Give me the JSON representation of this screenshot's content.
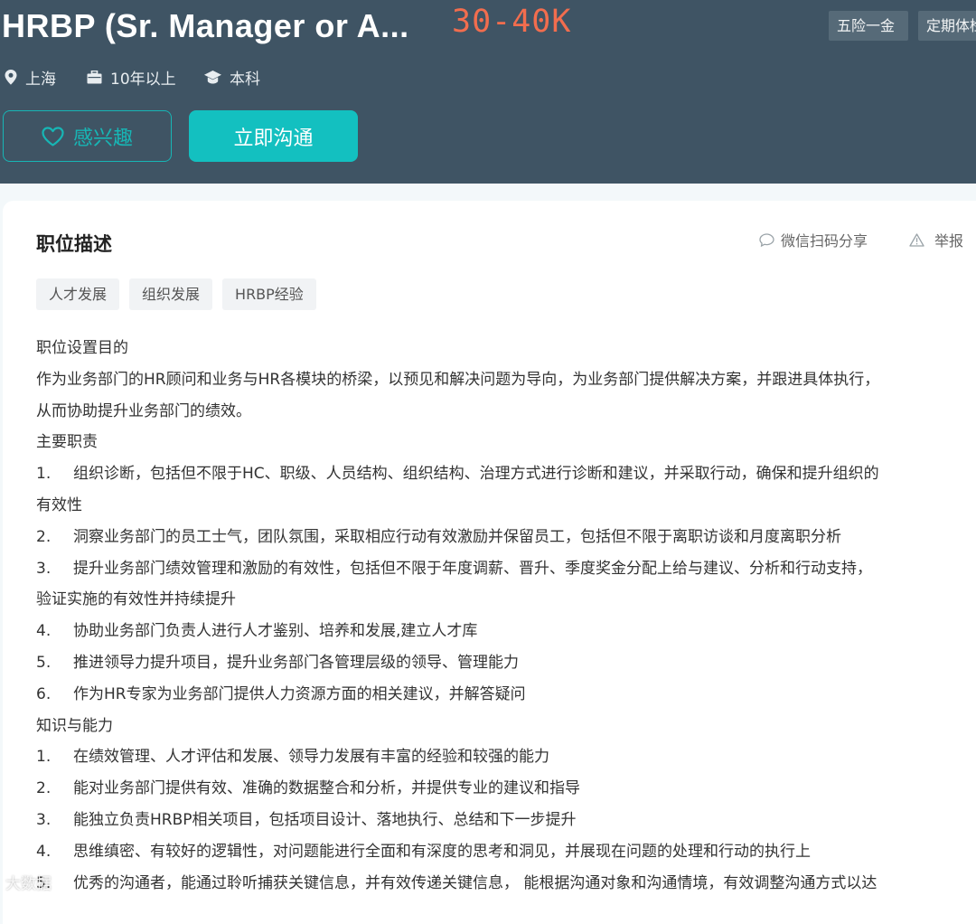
{
  "job": {
    "title": "HRBP (Sr. Manager or A...",
    "salary": "30-40K",
    "welfare": [
      "五险一金",
      "定期体检"
    ],
    "city": "上海",
    "experience": "10年以上",
    "education": "本科"
  },
  "actions": {
    "interest_label": "感兴趣",
    "chat_label": "立即沟通"
  },
  "section": {
    "title": "职位描述",
    "share_label": "微信扫码分享",
    "report_label": "举报",
    "tags": [
      "人才发展",
      "组织发展",
      "HRBP经验"
    ]
  },
  "description": {
    "heading1": "职位设置目的",
    "purpose_line1": "作为业务部门的HR顾问和业务与HR各模块的桥梁，以预见和解决问题为导向，为业务部门提供解决方案，并跟进具体执行，",
    "purpose_line2": "从而协助提升业务部门的绩效。",
    "heading2": "主要职责",
    "resp": [
      {
        "num": "1.",
        "text": "组织诊断，包括但不限于HC、职级、人员结构、组织结构、治理方式进行诊断和建议，并采取行动，确保和提升组织的"
      },
      {
        "num": "",
        "text": "有效性"
      },
      {
        "num": "2.",
        "text": "洞察业务部门的员工士气，团队氛围，采取相应行动有效激励并保留员工，包括但不限于离职访谈和月度离职分析"
      },
      {
        "num": "3.",
        "text": "提升业务部门绩效管理和激励的有效性，包括但不限于年度调薪、晋升、季度奖金分配上给与建议、分析和行动支持，"
      },
      {
        "num": "",
        "text": "验证实施的有效性并持续提升"
      },
      {
        "num": "4.",
        "text": "协助业务部门负责人进行人才鉴别、培养和发展,建立人才库"
      },
      {
        "num": "5.",
        "text": "推进领导力提升项目，提升业务部门各管理层级的领导、管理能力"
      },
      {
        "num": "6.",
        "text": "作为HR专家为业务部门提供人力资源方面的相关建议，并解答疑问"
      }
    ],
    "heading3": "知识与能力",
    "skills": [
      {
        "num": "1.",
        "text": "在绩效管理、人才评估和发展、领导力发展有丰富的经验和较强的能力"
      },
      {
        "num": "2.",
        "text": "能对业务部门提供有效、准确的数据整合和分析，并提供专业的建议和指导"
      },
      {
        "num": "3.",
        "text": "能独立负责HRBP相关项目，包括项目设计、落地执行、总结和下一步提升"
      },
      {
        "num": "4.",
        "text": "思维缜密、有较好的逻辑性，对问题能进行全面和有深度的思考和洞见，并展现在问题的处理和行动的执行上"
      },
      {
        "num": "5.",
        "text": "优秀的沟通者，能通过聆听捕获关键信息，并有效传递关键信息， 能根据沟通对象和沟通情境，有效调整沟通方式以达"
      }
    ]
  },
  "watermark": "大数据"
}
